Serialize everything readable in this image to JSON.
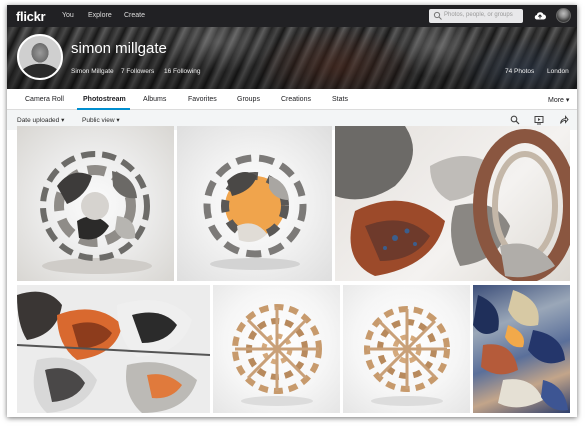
{
  "app": {
    "logo": "flickr"
  },
  "topnav": {
    "links": [
      "You",
      "Explore",
      "Create"
    ],
    "search_placeholder": "Photos, people, or groups",
    "icons": [
      "search-icon",
      "upload-cloud-icon",
      "user-avatar"
    ]
  },
  "profile": {
    "name": "simon millgate",
    "username": "Simon Millgate",
    "followers": "7 Followers",
    "following": "16 Following",
    "photos": "74 Photos",
    "location": "London"
  },
  "tabs": {
    "items": [
      "Camera Roll",
      "Photostream",
      "Albums",
      "Favorites",
      "Groups",
      "Creations",
      "Stats"
    ],
    "active": "Photostream",
    "more": "More"
  },
  "toolbar": {
    "sort": "Date uploaded",
    "view": "Public view",
    "icons": [
      "search-icon",
      "slideshow-icon",
      "share-icon"
    ]
  },
  "colors": {
    "topbar": "#212124",
    "accent": "#008ecf",
    "subbar": "#f3f5f6"
  },
  "photos": [
    {
      "subject": "paper sculpture sphere with grey marbled panels"
    },
    {
      "subject": "sculpture sphere with orange and marbled panels"
    },
    {
      "subject": "close-up of sculpture with rust and blue panels"
    },
    {
      "subject": "close-up of black and orange marbled sculpture"
    },
    {
      "subject": "wooden laser-cut sphere"
    },
    {
      "subject": "wooden laser-cut sphere"
    },
    {
      "subject": "colorful abstract blue artwork"
    }
  ]
}
